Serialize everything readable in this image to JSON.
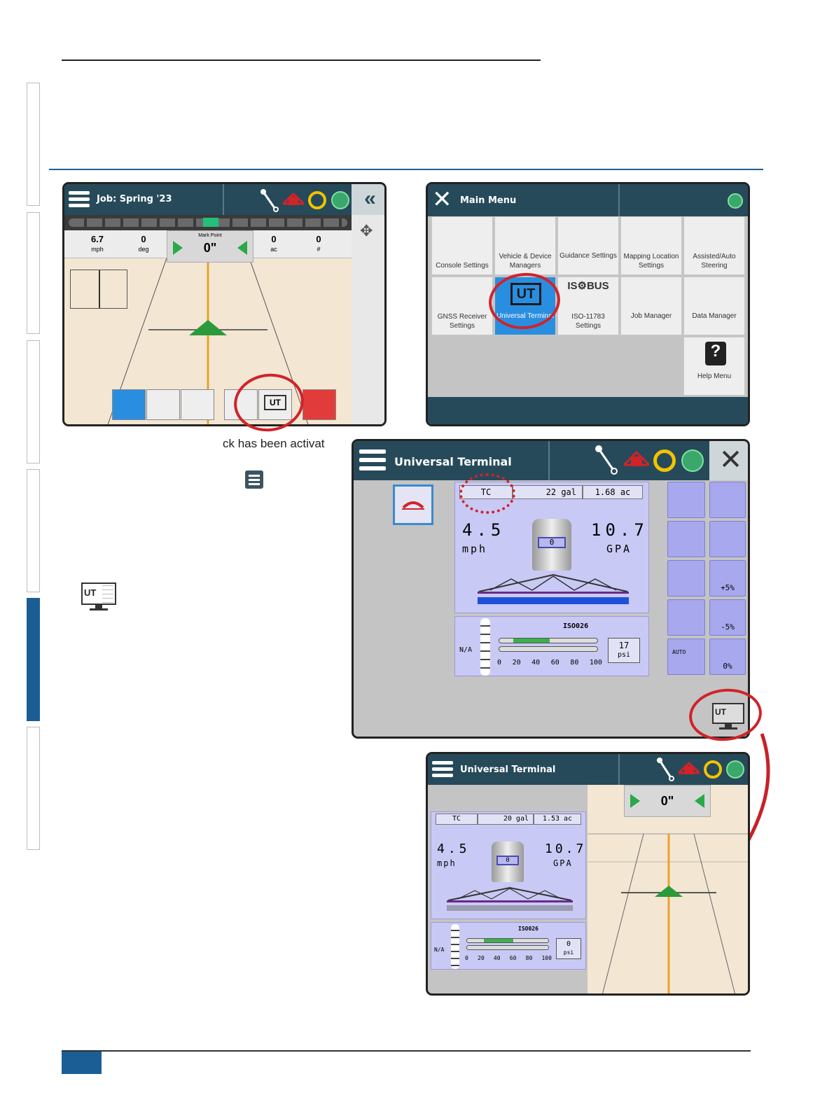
{
  "colors": {
    "accent": "#1b5e96",
    "titlebar": "#264a5a",
    "highlight_ring": "#d0232a",
    "ut_panel": "#c9c9f5"
  },
  "page": {
    "caption_fragment": "ck has been activat"
  },
  "screen1": {
    "title": "Job: Spring '23",
    "stats": [
      {
        "value": "6.7",
        "unit": "mph"
      },
      {
        "value": "0",
        "unit": "deg"
      },
      {
        "value": "0",
        "unit": "ac"
      },
      {
        "value": "0",
        "unit": "#"
      }
    ],
    "mark_point_label": "Mark Point",
    "mark_point_value": "0\"",
    "bottom_buttons": [
      "guidance-point-icon",
      "mapping-icon",
      "console-settings-icon",
      "job-manager-icon",
      "universal-terminal-icon",
      "product-icon"
    ],
    "ut_button_label": "UT"
  },
  "screen2": {
    "title": "Main Menu",
    "tiles": [
      {
        "label": "Console Settings",
        "icon": "console-settings-icon"
      },
      {
        "label": "Vehicle & Device Managers",
        "icon": "vehicle-device-icon"
      },
      {
        "label": "Guidance Settings",
        "icon": "guidance-settings-icon"
      },
      {
        "label": "Mapping Location Settings",
        "icon": "mapping-location-icon"
      },
      {
        "label": "Assisted/Auto Steering",
        "icon": "steering-wheel-icon"
      },
      {
        "label": "GNSS Receiver Settings",
        "icon": "gnss-icon"
      },
      {
        "label": "Universal Terminal",
        "icon": "universal-terminal-icon"
      },
      {
        "label": "ISO-11783 Settings",
        "icon": "isobus-icon"
      },
      {
        "label": "Job Manager",
        "icon": "job-manager-icon"
      },
      {
        "label": "Data Manager",
        "icon": "data-manager-icon"
      },
      {
        "label": "Help Menu",
        "icon": "help-icon"
      }
    ],
    "ut_label": "UT",
    "isobus_label": "IS⚙BUS"
  },
  "screen3": {
    "title": "Universal Terminal",
    "tc": "TC",
    "volume": "22 gal",
    "area": "1.68 ac",
    "speed": "4.5",
    "speed_unit": "mph",
    "rate": "10.7",
    "rate_unit": "GPA",
    "tank": "0",
    "nozzle": "ISO026",
    "na": "N/A",
    "gauge_ticks": [
      "0",
      "20",
      "40",
      "60",
      "80",
      "100"
    ],
    "pressure": "17",
    "pressure_unit": "psi",
    "right_buttons": [
      "+5%",
      "-5%",
      "0%"
    ],
    "auto_label": "AUTO",
    "ut_label": "UT"
  },
  "screen4": {
    "title": "Universal Terminal",
    "tc": "TC",
    "volume": "20 gal",
    "area": "1.53 ac",
    "speed": "4.5",
    "speed_unit": "mph",
    "rate": "10.7",
    "rate_unit": "GPA",
    "tank": "0",
    "nozzle": "ISO026",
    "na": "N/A",
    "gauge_ticks": [
      "0",
      "20",
      "40",
      "60",
      "80",
      "100"
    ],
    "pressure": "0",
    "pressure_unit": "psi",
    "guidance_value": "0\""
  },
  "inline_icons": {
    "menu": "menu-icon",
    "ut_map": "ut-map-icon",
    "ut_map_label": "UT"
  }
}
